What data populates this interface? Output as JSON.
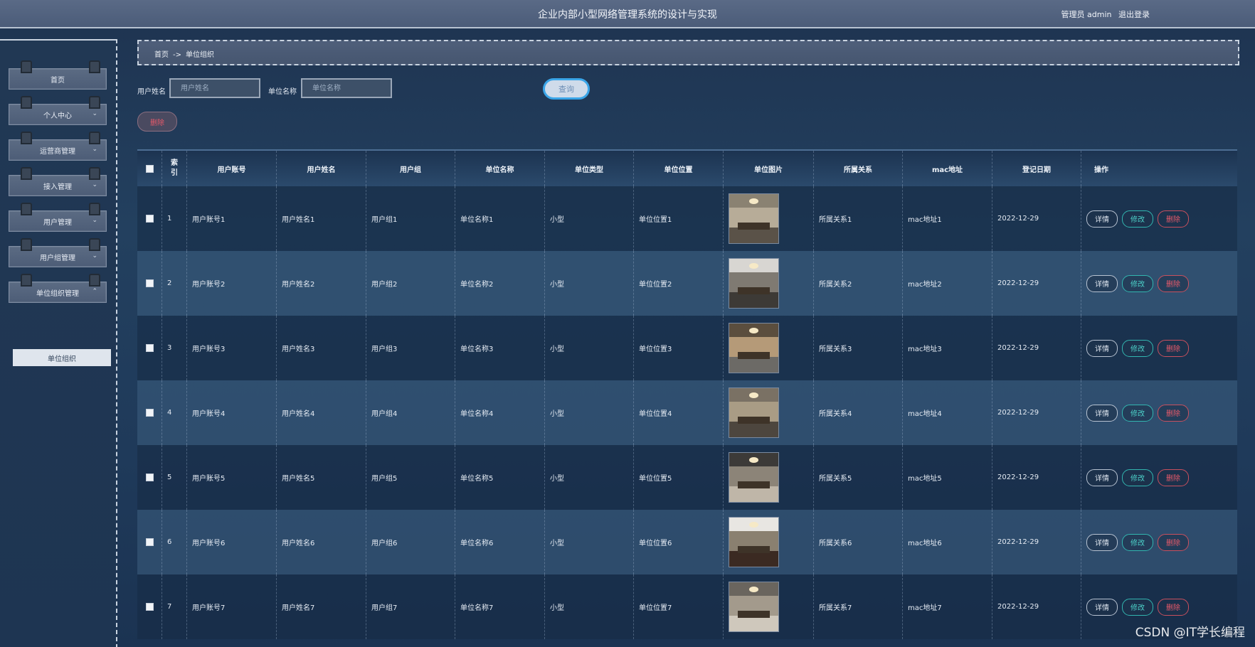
{
  "header": {
    "title": "企业内部小型网络管理系统的设计与实现",
    "user_label": "管理员 admin",
    "logout_label": "退出登录"
  },
  "sidebar": {
    "items": [
      {
        "label": "首页"
      },
      {
        "label": "个人中心"
      },
      {
        "label": "运营商管理"
      },
      {
        "label": "接入管理"
      },
      {
        "label": "用户管理"
      },
      {
        "label": "用户组管理"
      },
      {
        "label": "单位组织管理"
      }
    ],
    "submenu": {
      "label": "单位组织"
    }
  },
  "breadcrumb": {
    "home": "首页",
    "separator": "->",
    "current": "单位组织"
  },
  "search": {
    "username_label": "用户姓名",
    "username_placeholder": "用户姓名",
    "unitname_label": "单位名称",
    "unitname_placeholder": "单位名称",
    "query_label": "查询"
  },
  "actions": {
    "delete_label": "删除"
  },
  "table": {
    "headers": [
      "索引",
      "用户账号",
      "用户姓名",
      "用户组",
      "单位名称",
      "单位类型",
      "单位位置",
      "单位图片",
      "所属关系",
      "mac地址",
      "登记日期",
      "操作"
    ],
    "index_header_lines": [
      "索",
      "引"
    ],
    "ops": {
      "detail": "详情",
      "edit": "修改",
      "delete": "删除"
    },
    "rows": [
      {
        "index": "1",
        "account": "用户账号1",
        "name": "用户姓名1",
        "group": "用户组1",
        "unit_name": "单位名称1",
        "unit_type": "小型",
        "unit_location": "单位位置1",
        "relation": "所属关系1",
        "mac": "mac地址1",
        "date": "2022-12-29"
      },
      {
        "index": "2",
        "account": "用户账号2",
        "name": "用户姓名2",
        "group": "用户组2",
        "unit_name": "单位名称2",
        "unit_type": "小型",
        "unit_location": "单位位置2",
        "relation": "所属关系2",
        "mac": "mac地址2",
        "date": "2022-12-29"
      },
      {
        "index": "3",
        "account": "用户账号3",
        "name": "用户姓名3",
        "group": "用户组3",
        "unit_name": "单位名称3",
        "unit_type": "小型",
        "unit_location": "单位位置3",
        "relation": "所属关系3",
        "mac": "mac地址3",
        "date": "2022-12-29"
      },
      {
        "index": "4",
        "account": "用户账号4",
        "name": "用户姓名4",
        "group": "用户组4",
        "unit_name": "单位名称4",
        "unit_type": "小型",
        "unit_location": "单位位置4",
        "relation": "所属关系4",
        "mac": "mac地址4",
        "date": "2022-12-29"
      },
      {
        "index": "5",
        "account": "用户账号5",
        "name": "用户姓名5",
        "group": "用户组5",
        "unit_name": "单位名称5",
        "unit_type": "小型",
        "unit_location": "单位位置5",
        "relation": "所属关系5",
        "mac": "mac地址5",
        "date": "2022-12-29"
      },
      {
        "index": "6",
        "account": "用户账号6",
        "name": "用户姓名6",
        "group": "用户组6",
        "unit_name": "单位名称6",
        "unit_type": "小型",
        "unit_location": "单位位置6",
        "relation": "所属关系6",
        "mac": "mac地址6",
        "date": "2022-12-29"
      },
      {
        "index": "7",
        "account": "用户账号7",
        "name": "用户姓名7",
        "group": "用户组7",
        "unit_name": "单位名称7",
        "unit_type": "小型",
        "unit_location": "单位位置7",
        "relation": "所属关系7",
        "mac": "mac地址7",
        "date": "2022-12-29"
      }
    ]
  },
  "watermark": "CSDN @IT学长编程"
}
